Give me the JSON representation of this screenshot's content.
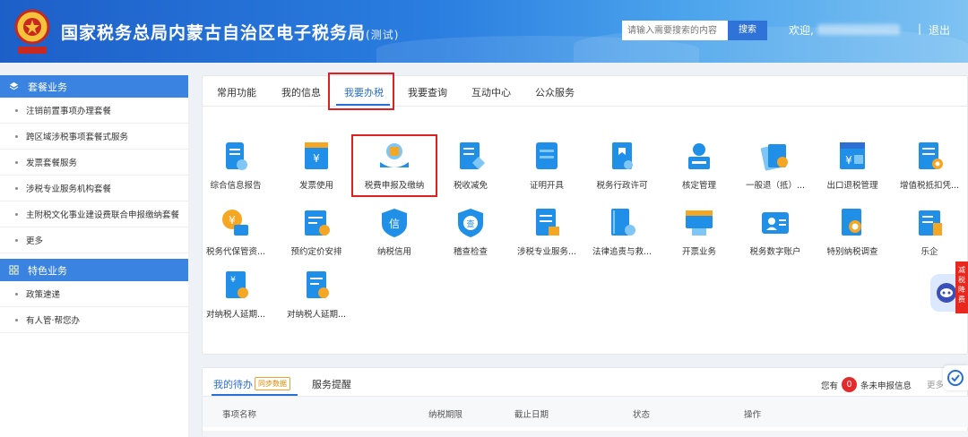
{
  "header": {
    "title": "国家税务总局内蒙古自治区电子税务局",
    "title_suffix": "(测试)",
    "search_placeholder": "请输入需要搜索的内容",
    "search_button": "搜索",
    "welcome": "欢迎,",
    "separator": "|",
    "logout": "退出",
    "brand_color": "#2a7ee0"
  },
  "sidebar": {
    "section1": {
      "title": "套餐业务",
      "items": [
        "注销前置事项办理套餐",
        "跨区域涉税事项套餐式服务",
        "发票套餐服务",
        "涉税专业服务机构套餐",
        "主附税文化事业建设费联合申报缴纳套餐",
        "更多"
      ]
    },
    "section2": {
      "title": "特色业务",
      "items": [
        "政策速递",
        "有人管·帮您办"
      ]
    }
  },
  "tabs": [
    "常用功能",
    "我的信息",
    "我要办税",
    "我要查询",
    "互动中心",
    "公众服务"
  ],
  "active_tab": "我要办税",
  "functions": [
    {
      "label": "综合信息报告",
      "icon": "report-icon"
    },
    {
      "label": "发票使用",
      "icon": "invoice-icon"
    },
    {
      "label": "税费申报及缴纳",
      "icon": "tax-payment-icon"
    },
    {
      "label": "税收减免",
      "icon": "tax-relief-icon"
    },
    {
      "label": "证明开具",
      "icon": "certificate-icon"
    },
    {
      "label": "税务行政许可",
      "icon": "license-icon"
    },
    {
      "label": "核定管理",
      "icon": "approval-icon"
    },
    {
      "label": "一般退（抵）...",
      "icon": "refund-icon"
    },
    {
      "label": "出口退税管理",
      "icon": "export-refund-icon"
    },
    {
      "label": "增值税抵扣凭...",
      "icon": "vat-deduction-icon"
    },
    {
      "label": "税务代保管资...",
      "icon": "custody-icon"
    },
    {
      "label": "预约定价安排",
      "icon": "pricing-icon"
    },
    {
      "label": "纳税信用",
      "icon": "credit-icon"
    },
    {
      "label": "稽查检查",
      "icon": "inspection-icon"
    },
    {
      "label": "涉税专业服务...",
      "icon": "professional-service-icon"
    },
    {
      "label": "法律追责与救...",
      "icon": "legal-icon"
    },
    {
      "label": "开票业务",
      "icon": "billing-icon"
    },
    {
      "label": "税务数字账户",
      "icon": "digital-account-icon"
    },
    {
      "label": "特别纳税调查",
      "icon": "special-investigation-icon"
    },
    {
      "label": "乐企",
      "icon": "leqi-icon"
    },
    {
      "label": "对纳税人延期...",
      "icon": "extension-icon"
    },
    {
      "label": "对纳税人延期...",
      "icon": "extension-icon-2"
    }
  ],
  "todo": {
    "tab_active": "我的待办",
    "sync_badge": "同步数据",
    "tab2": "服务提醒",
    "pending_prefix": "您有",
    "pending_count": "0",
    "pending_suffix": "条未申报信息",
    "more": "更多",
    "columns": [
      "事项名称",
      "纳税期限",
      "截止日期",
      "状态",
      "操作"
    ]
  },
  "float_badge": "减税降费"
}
